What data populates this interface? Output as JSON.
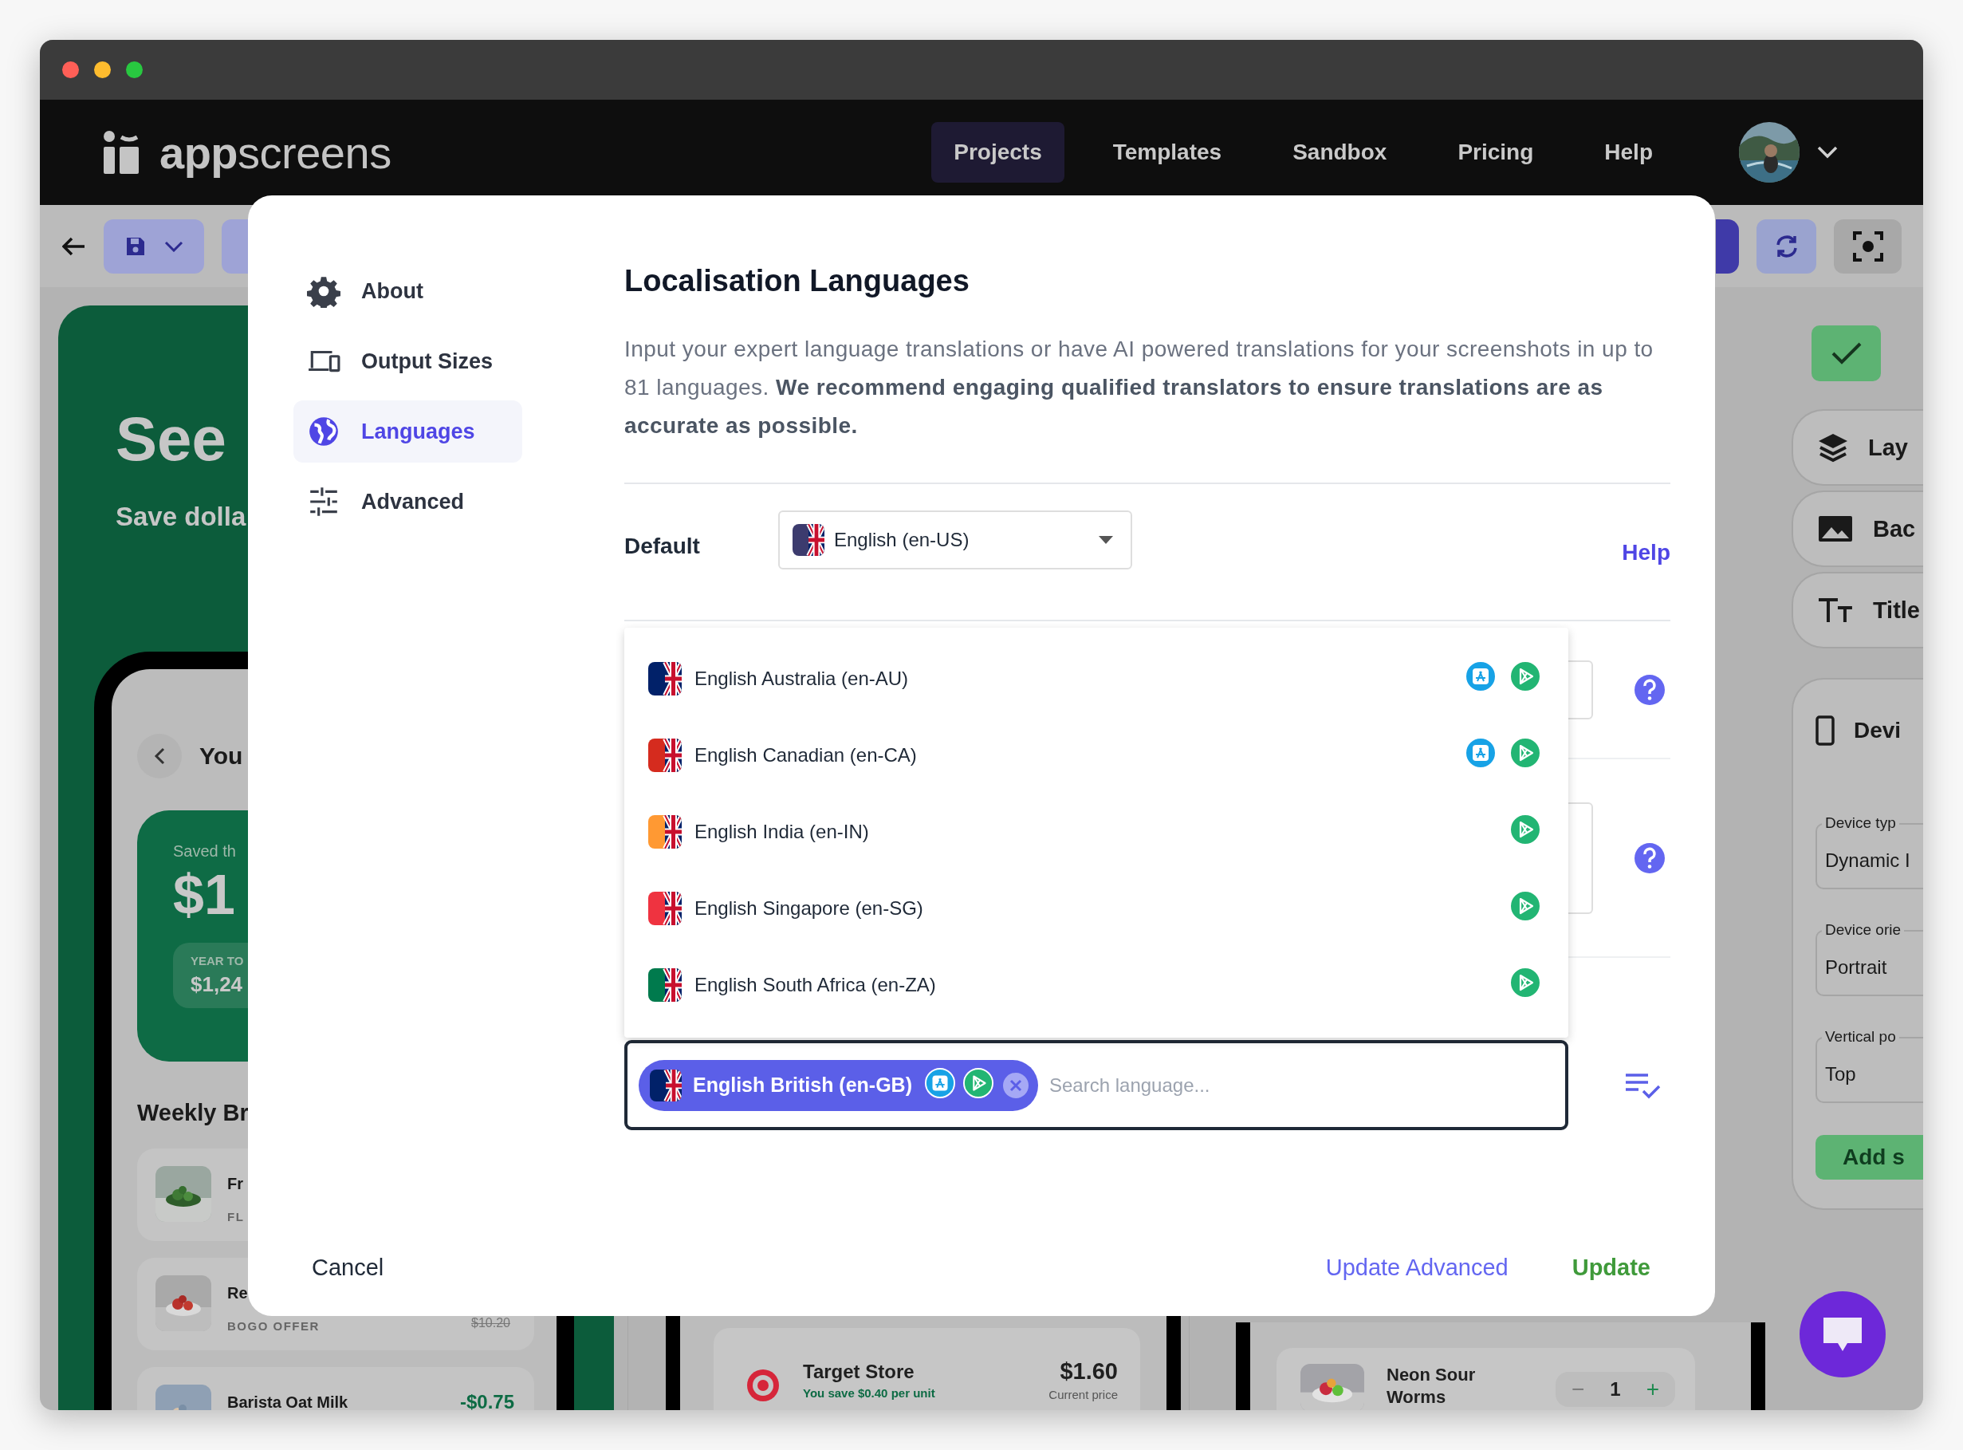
{
  "nav": {
    "logo": "**app**screens",
    "items": [
      {
        "label": "Projects",
        "selected": true
      },
      {
        "label": "Templates",
        "selected": false
      },
      {
        "label": "Sandbox",
        "selected": false
      },
      {
        "label": "Pricing",
        "selected": false
      },
      {
        "label": "Help",
        "selected": false
      }
    ]
  },
  "background": {
    "hero": {
      "title": "See",
      "subtitle": "Save dolla"
    },
    "phone": {
      "header": "You",
      "savings_label": "Saved th",
      "savings_amount": "$1",
      "year_label": "YEAR TO",
      "year_amount": "$1,24",
      "section_title": "Weekly Br",
      "deals": [
        {
          "name": "Fr",
          "tag": "FL"
        },
        {
          "name": "Re",
          "tag": "BOGO OFFER",
          "old_price": "$10.20"
        },
        {
          "name": "Barista Oat Milk",
          "price": "-$0.75"
        }
      ]
    },
    "store_card": {
      "name": "Target Store",
      "savings": "You save $0.40 per unit",
      "price": "$1.60",
      "price_label": "Current price"
    },
    "product_card": {
      "name": "Neon Sour Worms",
      "minus": "−",
      "quantity": "1",
      "plus": "+"
    },
    "sidebar": {
      "tabs": [
        "Lay",
        "Bac",
        "Title"
      ],
      "section": "Devi",
      "fields": [
        {
          "label": "Device typ",
          "value": "Dynamic I"
        },
        {
          "label": "Device orie",
          "value": "Portrait"
        },
        {
          "label": "Vertical po",
          "value": "Top"
        }
      ],
      "add_button": "Add s"
    }
  },
  "dialog": {
    "menu": [
      {
        "label": "About",
        "selected": false
      },
      {
        "label": "Output Sizes",
        "selected": false
      },
      {
        "label": "Languages",
        "selected": true
      },
      {
        "label": "Advanced",
        "selected": false
      }
    ],
    "title": "Localisation Languages",
    "description": "Input your expert language translations or have AI powered translations for your screenshots in up to 81 languages. **We recommend engaging qualified translators to ensure translations are as accurate as possible.**",
    "default_label": "Default",
    "default_value": {
      "label": "English (en-US)",
      "color": "#3c3b6e"
    },
    "help_link": "Help",
    "languages": [
      {
        "label": "English Australia (en-AU)",
        "color": "#012169",
        "app_store": true,
        "google_play": true
      },
      {
        "label": "English Canadian (en-CA)",
        "color": "#d52b1e",
        "app_store": true,
        "google_play": true
      },
      {
        "label": "English India (en-IN)",
        "color": "#ff9933",
        "app_store": false,
        "google_play": true
      },
      {
        "label": "English Singapore (en-SG)",
        "color": "#ef3340",
        "app_store": false,
        "google_play": true
      },
      {
        "label": "English South Africa (en-ZA)",
        "color": "#007a4d",
        "app_store": false,
        "google_play": true
      }
    ],
    "selected": [
      {
        "label": "English British (en-GB)",
        "color": "#012169",
        "app_store": true,
        "google_play": true
      }
    ],
    "search_placeholder": "Search language...",
    "cancel": "Cancel",
    "update_advanced": "Update Advanced",
    "update": "Update"
  }
}
